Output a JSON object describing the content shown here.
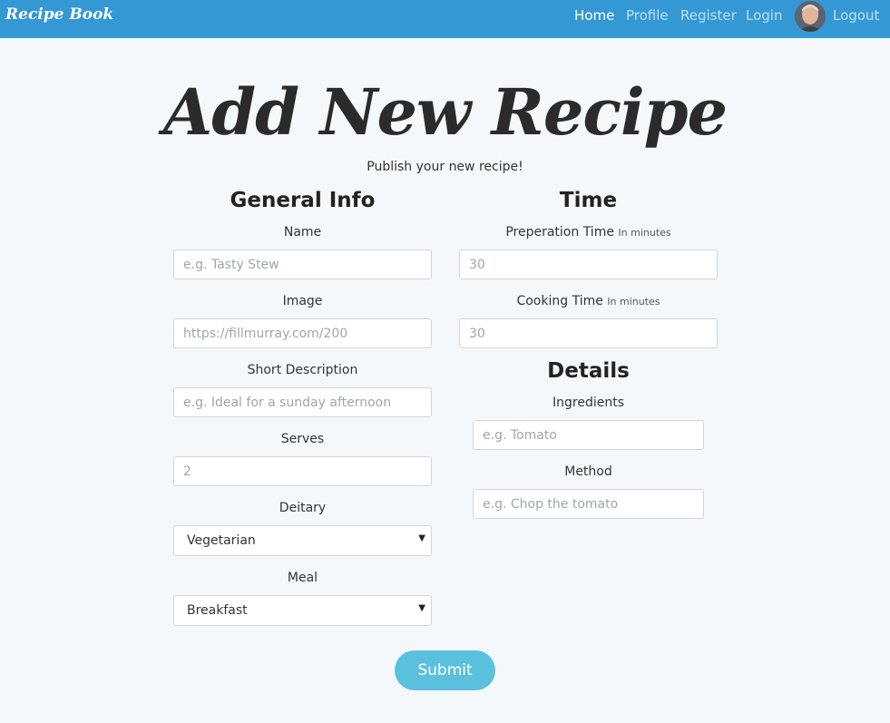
{
  "nav": {
    "brand": "Recipe Book",
    "links": [
      "Home",
      "Profile",
      "Register",
      "Login",
      "Logout"
    ]
  },
  "page": {
    "title": "Add New Recipe",
    "subtitle": "Publish your new recipe!"
  },
  "general": {
    "heading": "General Info",
    "name_label": "Name",
    "name_placeholder": "e.g. Tasty Stew",
    "image_label": "Image",
    "image_placeholder": "https://fillmurray.com/200",
    "desc_label": "Short Description",
    "desc_placeholder": "e.g. Ideal for a sunday afternoon",
    "serves_label": "Serves",
    "serves_placeholder": "2",
    "dietary_label": "Deitary",
    "dietary_value": "Vegetarian",
    "meal_label": "Meal",
    "meal_value": "Breakfast"
  },
  "time": {
    "heading": "Time",
    "prep_label": "Preperation Time",
    "prep_hint": "In minutes",
    "prep_placeholder": "30",
    "cook_label": "Cooking Time",
    "cook_hint": "In minutes",
    "cook_placeholder": "30"
  },
  "details": {
    "heading": "Details",
    "ingredients_label": "Ingredients",
    "ingredients_placeholder": "e.g. Tomato",
    "method_label": "Method",
    "method_placeholder": "e.g. Chop the tomato"
  },
  "submit_label": "Submit",
  "icons": {
    "caret": "caret-down-icon"
  },
  "colors": {
    "navbar": "#3498d5",
    "submit": "#5bc0de",
    "background": "#f4f8fb"
  }
}
